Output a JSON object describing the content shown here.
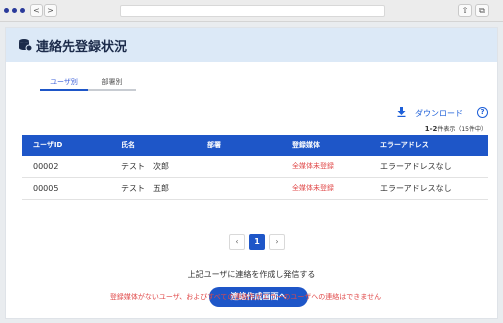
{
  "browser": {
    "back": "<",
    "forward": ">",
    "share": "⇧",
    "tabs": "⧉"
  },
  "header": {
    "title": "連絡先登録状況"
  },
  "tabs": [
    {
      "label": "ユーザ別"
    },
    {
      "label": "部署別"
    }
  ],
  "toolbar": {
    "download_label": "ダウンロード",
    "help": "?"
  },
  "count": {
    "range": "1-2",
    "suffix": "件表示（15件中）"
  },
  "table": {
    "headers": [
      "ユーザID",
      "氏名",
      "部署",
      "登録媒体",
      "エラーアドレス"
    ],
    "rows": [
      [
        "00002",
        "テスト　次郎",
        "",
        "全媒体未登録",
        "エラーアドレスなし"
      ],
      [
        "00005",
        "テスト　五郎",
        "",
        "全媒体未登録",
        "エラーアドレスなし"
      ]
    ]
  },
  "pagination": {
    "prev": "‹",
    "current": "1",
    "next": "›"
  },
  "footer": {
    "note": "上記ユーザに連絡を作成し発信する",
    "button_label": "連絡作成画面へ",
    "warning": "登録媒体がないユーザ、およびすべての連絡先がエラーのユーザへの連絡はできません"
  },
  "colors": {
    "accent": "#1e56c8",
    "header_bg": "#dce9f7",
    "error": "#e04848"
  }
}
